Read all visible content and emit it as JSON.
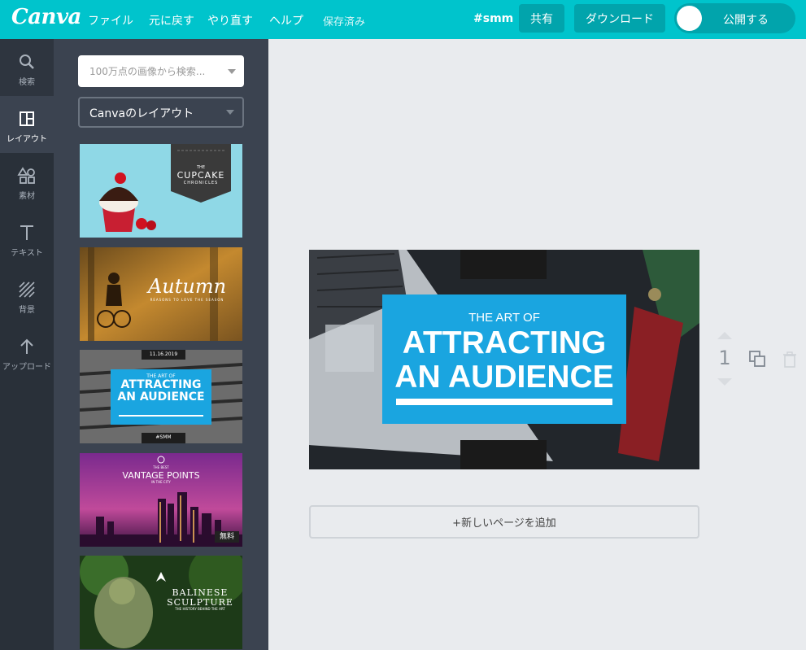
{
  "app": {
    "logo": "Canva"
  },
  "topbar": {
    "menu": [
      "ファイル",
      "元に戻す",
      "やり直す",
      "ヘルプ"
    ],
    "status": "保存済み",
    "tag": "#smm",
    "share_label": "共有",
    "download_label": "ダウンロード",
    "publish_label": "公開する"
  },
  "rail": {
    "items": [
      {
        "label": "検索",
        "icon": "search-icon"
      },
      {
        "label": "レイアウト",
        "icon": "layout-icon"
      },
      {
        "label": "素材",
        "icon": "elements-icon"
      },
      {
        "label": "テキスト",
        "icon": "text-icon"
      },
      {
        "label": "背景",
        "icon": "background-icon"
      },
      {
        "label": "アップロード",
        "icon": "upload-icon"
      }
    ]
  },
  "panel": {
    "search_placeholder": "100万点の画像から検索...",
    "layout_select": "Canvaのレイアウト",
    "thumbnails": [
      {
        "lines": [
          "THE",
          "CUPCAKE",
          "CHRONICLES"
        ]
      },
      {
        "title": "Autumn",
        "subtitle": "REASONS TO LOVE THE SEASON"
      },
      {
        "date": "11.16.2019",
        "lines": [
          "THE ART OF",
          "ATTRACTING",
          "AN AUDIENCE"
        ],
        "tag": "#SMM"
      },
      {
        "small": "THE BEST",
        "title": "VANTAGE POINTS",
        "sub": "IN THE CITY",
        "badge": "無料"
      },
      {
        "lines": [
          "BALINESE",
          "SCULPTURE"
        ],
        "sub": "THE HISTORY BEHIND THE ART"
      }
    ]
  },
  "design": {
    "kicker": "THE ART OF",
    "line1": "ATTRACTING",
    "line2": "AN AUDIENCE",
    "accent": "#1aa5e0"
  },
  "page_controls": {
    "page_number": "1"
  },
  "add_page_label": "+新しいページを追加"
}
